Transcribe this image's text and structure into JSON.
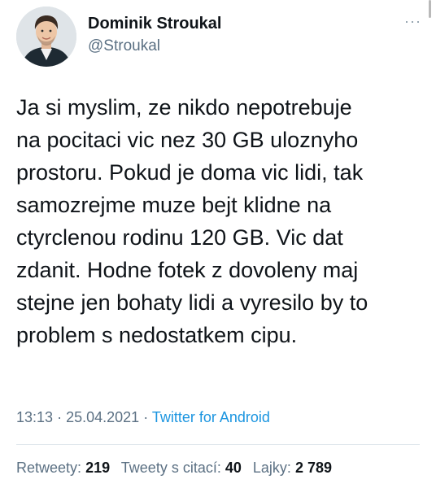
{
  "author": {
    "display_name": "Dominik Stroukal",
    "handle": "@Stroukal"
  },
  "more_icon": "more-options-icon",
  "tweet_text": "Ja si myslim, ze nikdo nepotrebuje\nna pocitaci vic nez 30 GB uloznyho\nprostoru. Pokud je doma vic lidi, tak\nsamozrejme muze bejt klidne na\nctyrclenou rodinu 120 GB. Vic dat\nzdanit. Hodne fotek z dovoleny maj\nstejne jen bohaty lidi a vyresilo by to\nproblem s nedostatkem cipu.",
  "meta": {
    "time": "13:13",
    "date": "25.04.2021",
    "separator": "·",
    "source": "Twitter for Android"
  },
  "stats": {
    "retweets_label": "Retweety:",
    "retweets_value": "219",
    "quotes_label": "Tweety s citací:",
    "quotes_value": "40",
    "likes_label": "Lajky:",
    "likes_value": "2 789"
  },
  "colors": {
    "text": "#0f1419",
    "secondary": "#5b7083",
    "link": "#1b95e0",
    "divider": "#e1e8ed"
  }
}
